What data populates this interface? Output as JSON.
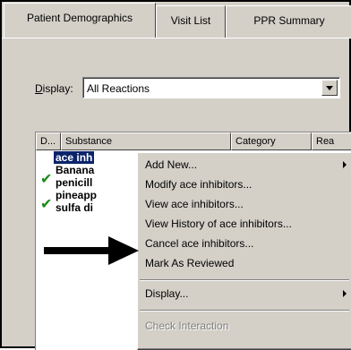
{
  "tabs": [
    {
      "label": "Patient Demographics"
    },
    {
      "label": "Visit List"
    },
    {
      "label": "PPR Summary"
    }
  ],
  "display": {
    "label_prefix": "D",
    "label_rest": "isplay:",
    "selected": "All Reactions"
  },
  "table": {
    "headers": [
      "D...",
      "Substance",
      "Category",
      "Rea"
    ],
    "rows": [
      {
        "substance": "ace inh",
        "checked": false,
        "selected": true
      },
      {
        "substance": "Banana",
        "checked": false,
        "selected": false
      },
      {
        "substance": "penicill",
        "checked": true,
        "selected": false
      },
      {
        "substance": "pineapp",
        "checked": false,
        "selected": false
      },
      {
        "substance": "sulfa di",
        "checked": true,
        "selected": false
      }
    ]
  },
  "context_menu": {
    "items": [
      {
        "label": "Add New...",
        "submenu": true,
        "enabled": true
      },
      {
        "label": "Modify ace inhibitors...",
        "submenu": false,
        "enabled": true
      },
      {
        "label": "View ace inhibitors...",
        "submenu": false,
        "enabled": true
      },
      {
        "label": "View History of ace inhibitors...",
        "submenu": false,
        "enabled": true
      },
      {
        "label": "Cancel ace inhibitors...",
        "submenu": false,
        "enabled": true
      },
      {
        "label": "Mark As Reviewed",
        "submenu": false,
        "enabled": true
      },
      {
        "label": "Display...",
        "submenu": true,
        "enabled": true
      },
      {
        "label": "Check Interaction",
        "submenu": false,
        "enabled": false
      }
    ]
  },
  "icons": {
    "check": "check-mark-icon",
    "pointer": "arrow-right-icon",
    "dropdown": "chevron-down-icon",
    "submenu": "triangle-right-icon"
  },
  "colors": {
    "selection": "#0a246a",
    "check": "#1a8a1a",
    "face": "#d4d0c8"
  }
}
